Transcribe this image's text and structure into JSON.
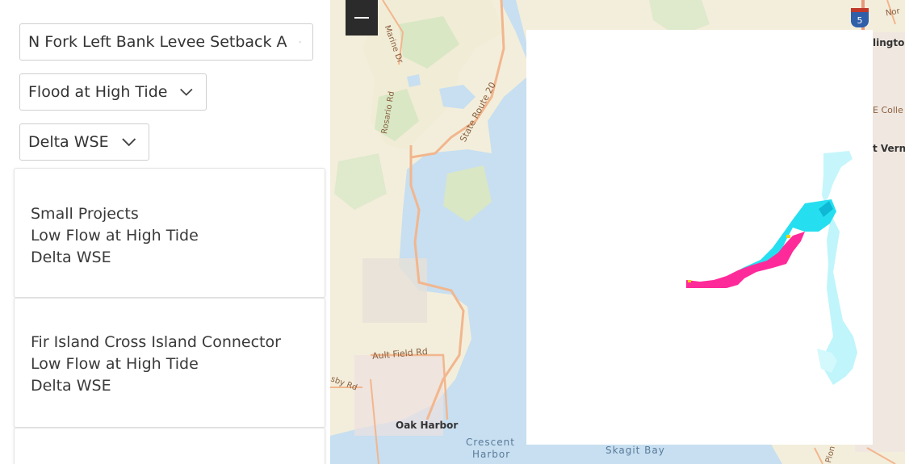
{
  "panel": {
    "project_select": {
      "value": "N Fork Left Bank Levee Setback A"
    },
    "scenario_select": {
      "value": "Flood at High Tide"
    },
    "variable_select": {
      "value": "Delta WSE"
    },
    "cards": [
      {
        "lines": [
          "Small Projects",
          "Low Flow at High Tide",
          "Delta WSE"
        ]
      },
      {
        "lines": [
          "Fir Island Cross Island Connector",
          "Low Flow at High Tide",
          "Delta WSE"
        ]
      },
      {
        "lines": []
      }
    ]
  },
  "map": {
    "labels": {
      "marine": "Marine Dr",
      "rosario": "Rosario Rd",
      "state_route": "State Route 20",
      "ault_field": "Ault Field Rd",
      "oak_harbor": "Oak Harbor",
      "crescent_1": "Crescent",
      "crescent_2": "Harbor",
      "skagit_bay": "Skagit Bay",
      "bylabel": "sby Rd",
      "burlington": "lingto",
      "college": "E Colle",
      "vernon": "t Vern",
      "north": "Nor",
      "interstate": "5",
      "pioneer": "Pion"
    },
    "colors": {
      "water": "#c7dff0",
      "land": "#f3eedb",
      "green": "#d6e6c2",
      "road": "#f2b68e",
      "flood_magenta": "#ff2a9a",
      "flood_cyan": "#20e0ee",
      "flood_light": "#bff5fb"
    }
  },
  "controls": {
    "zoom_out_icon": "minus-icon"
  }
}
